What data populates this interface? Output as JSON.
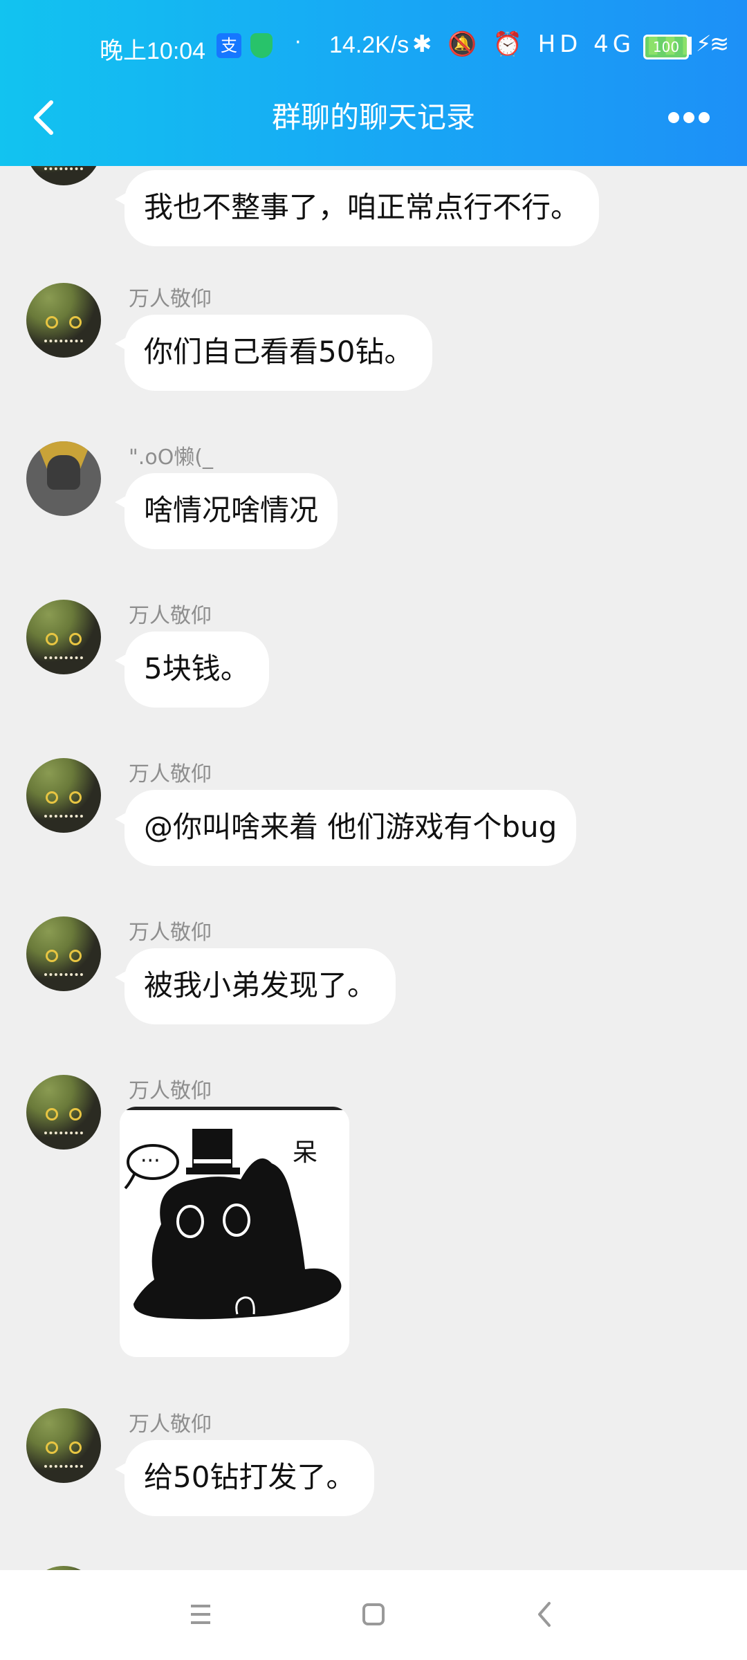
{
  "status_bar": {
    "time": "晚上10:04",
    "alipay_icon": "支",
    "dot": "·",
    "net_speed": "14.2K/s",
    "icons": "✱ 🔕 ⏰ HD 4G ▮▮▮ ≋",
    "battery": "100",
    "bolt": "⚡"
  },
  "header": {
    "title": "群聊的聊天记录",
    "back_icon": "chevron-left-icon",
    "more_icon": "more-horizontal-icon"
  },
  "messages": [
    {
      "type": "text",
      "sender": "",
      "avatar": "cat",
      "text": "我也不整事了，咱正常点行不行。"
    },
    {
      "type": "text",
      "sender": "万人敬仰",
      "avatar": "cat",
      "text": "你们自己看看50钻。"
    },
    {
      "type": "text",
      "sender": "\".oO懒(_",
      "avatar": "gray",
      "text": "啥情况啥情况"
    },
    {
      "type": "text",
      "sender": "万人敬仰",
      "avatar": "cat",
      "text": "5块钱。"
    },
    {
      "type": "text",
      "sender": "万人敬仰",
      "avatar": "cat",
      "text": "@你叫啥来着 他们游戏有个bug"
    },
    {
      "type": "text",
      "sender": "万人敬仰",
      "avatar": "cat",
      "text": "被我小弟发现了。"
    },
    {
      "type": "sticker",
      "sender": "万人敬仰",
      "avatar": "cat",
      "sticker_text": "呆",
      "sticker_dots": "···"
    },
    {
      "type": "text",
      "sender": "万人敬仰",
      "avatar": "cat",
      "text": "给50钻打发了。"
    }
  ],
  "nav_bar": {
    "menu_icon": "menu-icon",
    "home_icon": "home-square-icon",
    "back_icon": "back-triangle-icon"
  },
  "colors": {
    "header_gradient_start": "#12c3f0",
    "header_gradient_end": "#1d90f7",
    "chat_background": "#efefef",
    "bubble": "#ffffff",
    "sender_name": "#8e8e8e"
  }
}
